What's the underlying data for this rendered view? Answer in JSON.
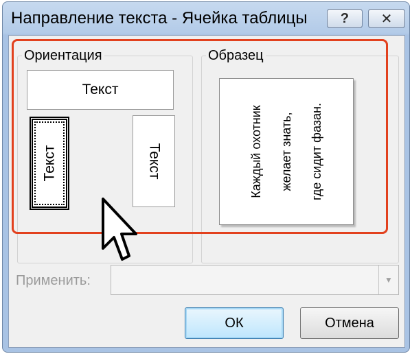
{
  "window": {
    "title": "Направление текста - Ячейка таблицы",
    "help_label": "?",
    "close_label": "✕"
  },
  "orientation": {
    "legend": "Ориентация",
    "options": [
      {
        "label": "Текст",
        "direction": "horizontal"
      },
      {
        "label": "Текст",
        "direction": "vertical-up",
        "selected": true
      },
      {
        "label": "Текст",
        "direction": "vertical-down"
      }
    ]
  },
  "sample": {
    "legend": "Образец",
    "lines": [
      "Каждый охотник",
      "желает знать,",
      "где сидит фазан."
    ]
  },
  "apply": {
    "label": "Применить:",
    "value": "",
    "arrow": "▼"
  },
  "buttons": {
    "ok": "ОК",
    "cancel": "Отмена"
  },
  "colors": {
    "highlight": "#e2411e"
  },
  "cursor_icon": "mouse-pointer-icon"
}
